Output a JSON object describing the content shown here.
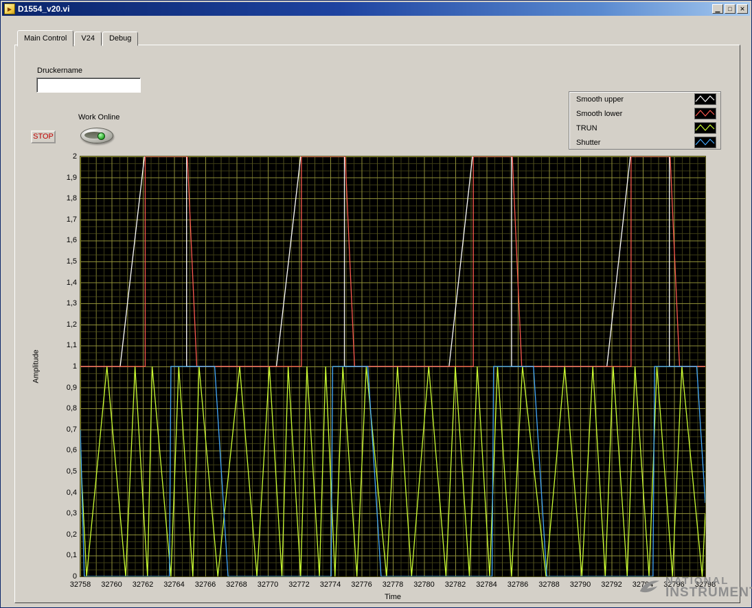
{
  "window": {
    "title": "D1554_v20.vi",
    "buttons": {
      "minimize": "▁",
      "maximize": "□",
      "close": "✕"
    }
  },
  "tabs": [
    {
      "label": "Main Control",
      "selected": true
    },
    {
      "label": "V24",
      "selected": false
    },
    {
      "label": "Debug",
      "selected": false
    }
  ],
  "controls": {
    "druckername_label": "Druckername",
    "druckername_value": "",
    "work_online_label": "Work Online",
    "stop_label": "STOP"
  },
  "legend": {
    "items": [
      {
        "label": "Smooth upper",
        "color": "#ffffff"
      },
      {
        "label": "Smooth lower",
        "color": "#ff5a50"
      },
      {
        "label": "TRUN",
        "color": "#ccff33"
      },
      {
        "label": "Shutter",
        "color": "#44aaff"
      }
    ]
  },
  "colors": {
    "titlebar_left": "#0a246a",
    "titlebar_right": "#a6caf0",
    "panel_bg": "#d4d0c8",
    "plot_bg": "#000000",
    "grid_major": "#8f8f38",
    "grid_minor": "#3a3a14",
    "stop_text": "#c00000",
    "led_green": "#28a828"
  },
  "chart_data": {
    "type": "line",
    "title": "",
    "xlabel": "Time",
    "ylabel": "Amplitude",
    "xlim": [
      32758,
      32798
    ],
    "ylim": [
      0,
      2
    ],
    "grid": true,
    "legend_position": "top-right",
    "x_ticks": [
      "32758",
      "32760",
      "32762",
      "32764",
      "32766",
      "32768",
      "32770",
      "32772",
      "32774",
      "32776",
      "32778",
      "32780",
      "32782",
      "32784",
      "32786",
      "32788",
      "32790",
      "32792",
      "32794",
      "32796",
      "32798"
    ],
    "y_ticks": [
      "2",
      "1,9",
      "1,8",
      "1,7",
      "1,6",
      "1,5",
      "1,4",
      "1,3",
      "1,2",
      "1,1",
      "1",
      "0,9",
      "0,8",
      "0,7",
      "0,6",
      "0,5",
      "0,4",
      "0,3",
      "0,2",
      "0,1",
      "0"
    ],
    "series": [
      {
        "name": "Smooth upper",
        "color": "#ffffff",
        "points": [
          [
            32758,
            1
          ],
          [
            32760.55,
            1
          ],
          [
            32762.1,
            2
          ],
          [
            32764.8,
            2
          ],
          [
            32764.8,
            1
          ],
          [
            32770.55,
            1
          ],
          [
            32772.1,
            2
          ],
          [
            32774.9,
            2
          ],
          [
            32774.9,
            1
          ],
          [
            32781.6,
            1
          ],
          [
            32783.1,
            2
          ],
          [
            32785.6,
            2
          ],
          [
            32785.6,
            1
          ],
          [
            32791.7,
            1
          ],
          [
            32793.2,
            2
          ],
          [
            32795.7,
            2
          ],
          [
            32795.7,
            1
          ],
          [
            32798,
            1
          ]
        ]
      },
      {
        "name": "Smooth lower",
        "color": "#ff5a50",
        "points": [
          [
            32758,
            1
          ],
          [
            32762.15,
            1
          ],
          [
            32762.15,
            2
          ],
          [
            32764.85,
            2
          ],
          [
            32765.45,
            1
          ],
          [
            32772.15,
            1
          ],
          [
            32772.15,
            2
          ],
          [
            32774.95,
            2
          ],
          [
            32775.55,
            1
          ],
          [
            32783.15,
            1
          ],
          [
            32783.15,
            2
          ],
          [
            32785.65,
            2
          ],
          [
            32786.25,
            1
          ],
          [
            32793.25,
            1
          ],
          [
            32793.25,
            2
          ],
          [
            32795.75,
            2
          ],
          [
            32796.35,
            1
          ],
          [
            32798,
            1
          ]
        ]
      },
      {
        "name": "TRUN",
        "color": "#ccff33",
        "points": [
          [
            32758,
            0.6
          ],
          [
            32758.4,
            0
          ],
          [
            32759.7,
            1
          ],
          [
            32760.9,
            0
          ],
          [
            32761.5,
            1
          ],
          [
            32762.3,
            0
          ],
          [
            32762.6,
            1
          ],
          [
            32763.8,
            0
          ],
          [
            32764.3,
            1
          ],
          [
            32765.2,
            0
          ],
          [
            32765.6,
            1
          ],
          [
            32766.8,
            0
          ],
          [
            32768.2,
            1
          ],
          [
            32769.3,
            0
          ],
          [
            32770.1,
            1
          ],
          [
            32770.9,
            0
          ],
          [
            32771.3,
            1
          ],
          [
            32772.1,
            0
          ],
          [
            32772.5,
            1
          ],
          [
            32773.3,
            0
          ],
          [
            32773.7,
            1
          ],
          [
            32774.3,
            0
          ],
          [
            32774.8,
            1
          ],
          [
            32775.7,
            0
          ],
          [
            32776.3,
            1
          ],
          [
            32777.6,
            0
          ],
          [
            32778.3,
            1
          ],
          [
            32779.2,
            0
          ],
          [
            32780.3,
            1
          ],
          [
            32781.4,
            0
          ],
          [
            32782,
            1
          ],
          [
            32782.9,
            0
          ],
          [
            32783.4,
            1
          ],
          [
            32784.2,
            0
          ],
          [
            32784.7,
            1
          ],
          [
            32785.6,
            0
          ],
          [
            32786.3,
            1
          ],
          [
            32787.8,
            0
          ],
          [
            32789,
            1
          ],
          [
            32790.1,
            0
          ],
          [
            32790.8,
            1
          ],
          [
            32791.6,
            0
          ],
          [
            32792.1,
            1
          ],
          [
            32793,
            0
          ],
          [
            32793.5,
            1
          ],
          [
            32794.4,
            0
          ],
          [
            32794.9,
            1
          ],
          [
            32795.9,
            0
          ],
          [
            32796.5,
            1
          ],
          [
            32797.8,
            0
          ],
          [
            32798,
            0.3
          ]
        ]
      },
      {
        "name": "Shutter",
        "color": "#44aaff",
        "points": [
          [
            32758,
            0.7
          ],
          [
            32758.25,
            0
          ],
          [
            32763.7,
            0
          ],
          [
            32763.8,
            1
          ],
          [
            32766.6,
            1
          ],
          [
            32767.45,
            0
          ],
          [
            32774.05,
            0
          ],
          [
            32774.15,
            1
          ],
          [
            32776.4,
            1
          ],
          [
            32777.25,
            0
          ],
          [
            32784.35,
            0
          ],
          [
            32784.45,
            1
          ],
          [
            32787,
            1
          ],
          [
            32787.85,
            0
          ],
          [
            32794.65,
            0
          ],
          [
            32794.75,
            1
          ],
          [
            32797.45,
            1
          ],
          [
            32798,
            0.35
          ]
        ]
      }
    ]
  },
  "watermark": {
    "line1": "NATIONAL",
    "line2": "INSTRUMENTS"
  }
}
